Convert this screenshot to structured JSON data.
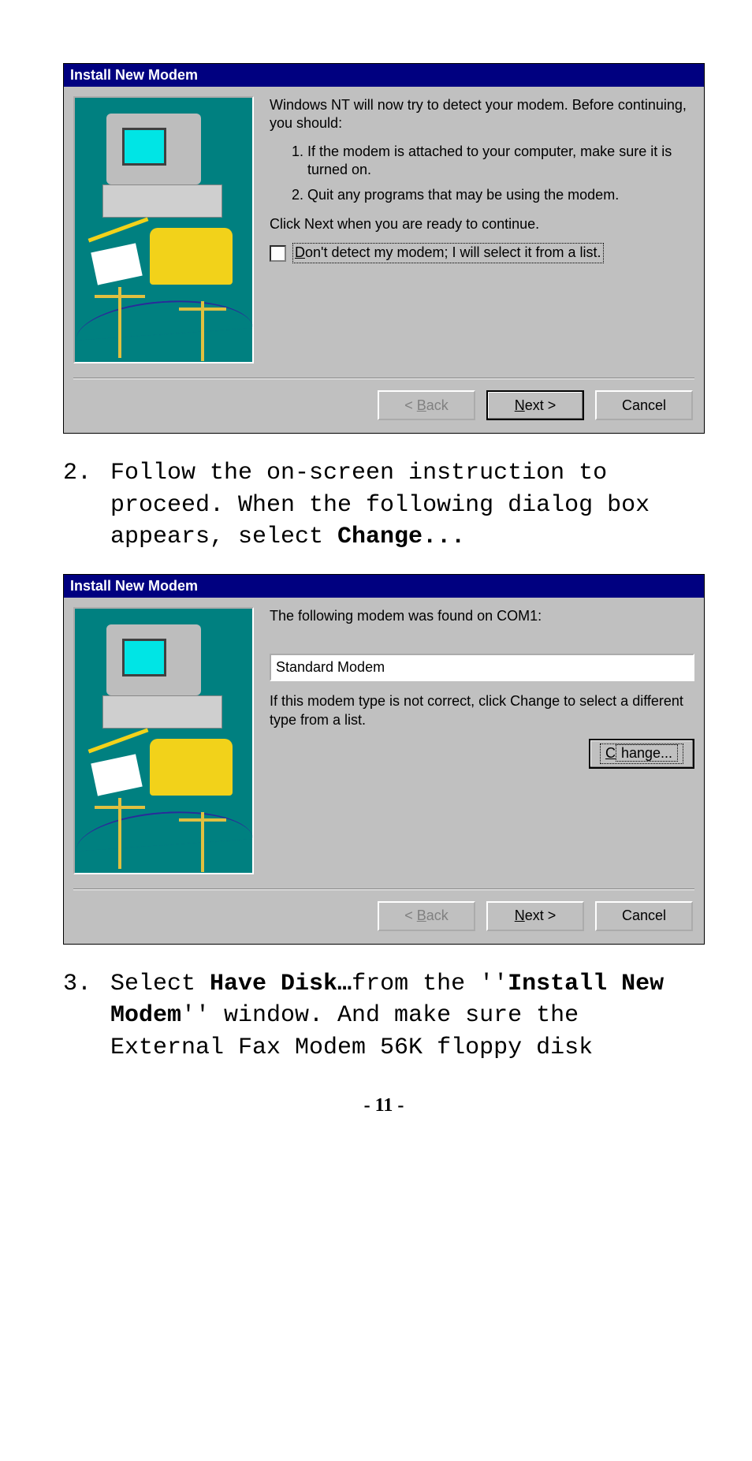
{
  "dialog1": {
    "title": "Install New Modem",
    "intro": "Windows NT will now try to detect your modem.  Before continuing, you should:",
    "li1": "If the modem is attached to your computer, make sure it is turned on.",
    "li2": "Quit any programs that may be using the modem.",
    "ready": "Click Next when you are ready to continue.",
    "checkbox_prefix": "D",
    "checkbox_rest": "on't detect my modem; I will select it from a list.",
    "back_prefix": "< ",
    "back_u": "B",
    "back_rest": "ack",
    "next_u": "N",
    "next_rest": "ext >",
    "cancel": "Cancel"
  },
  "step2": {
    "num": "2.",
    "t1": "Follow the on-screen instruction to proceed. When the following dialog box appears, select ",
    "bold": "Change..."
  },
  "dialog2": {
    "title": "Install New Modem",
    "found": "The following modem was found on COM1:",
    "modem": "Standard Modem",
    "hint": "If this modem type is not correct, click Change to select a different type from a list.",
    "change_u": "C",
    "change_rest": "hange...",
    "back_prefix": "< ",
    "back_u": "B",
    "back_rest": "ack",
    "next_u": "N",
    "next_rest": "ext >",
    "cancel": "Cancel"
  },
  "step3": {
    "num": "3.",
    "t1": "Select ",
    "b1": "Have Disk…",
    "t2": "from the ''",
    "b2": "Install New Modem",
    "t3": "'' window. And make sure the External Fax Modem 56K floppy disk"
  },
  "footer": "- 11 -"
}
